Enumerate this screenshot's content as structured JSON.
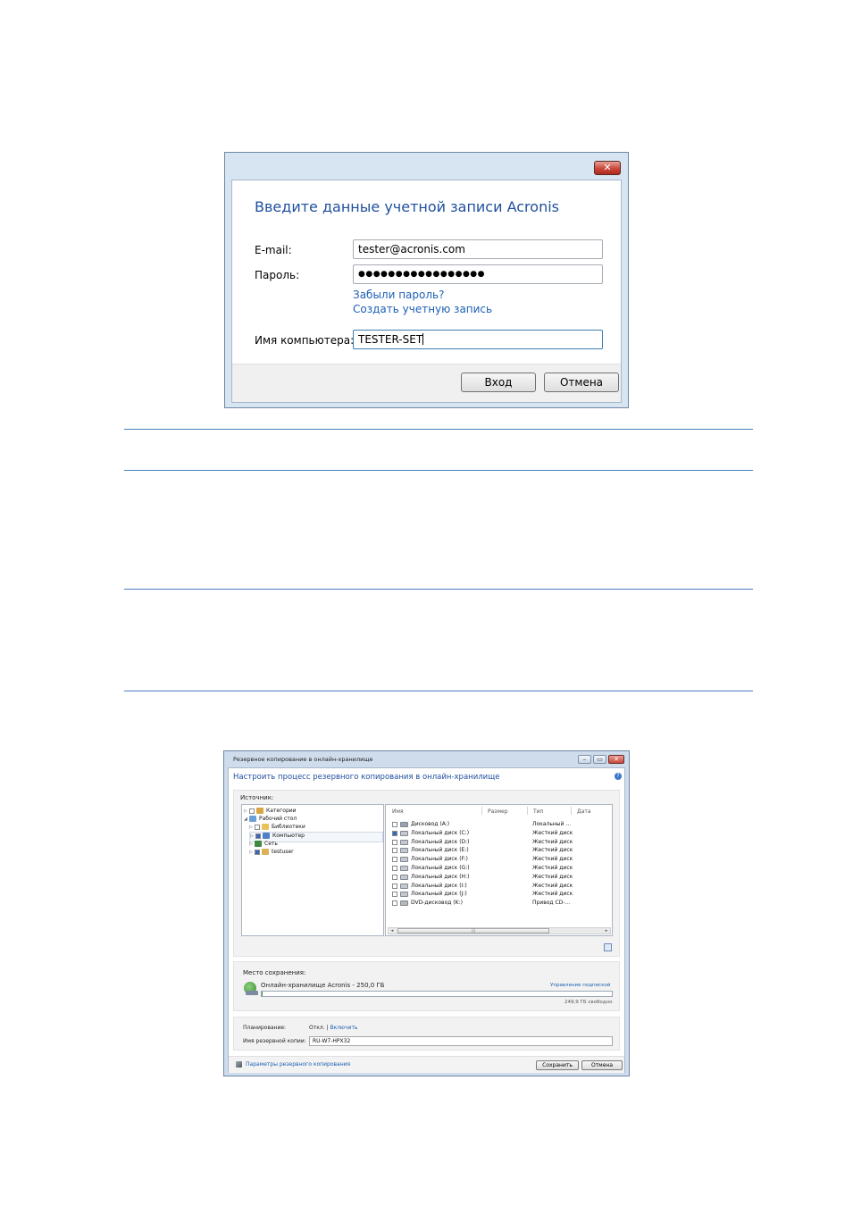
{
  "login_dialog": {
    "close_label": "✕",
    "title": "Введите данные учетной записи Acronis",
    "email_label": "E-mail:",
    "email_value": "tester@acronis.com",
    "password_label": "Пароль:",
    "password_value": "●●●●●●●●●●●●●●●●●",
    "forgot_password": "Забыли пароль?",
    "create_account": "Создать учетную запись",
    "computer_label": "Имя компьютера:",
    "computer_value": "TESTER-SET",
    "login_button": "Вход",
    "cancel_button": "Отмена"
  },
  "backup_dialog": {
    "window_title": "Резервное копирование в онлайн-хранилище",
    "window_buttons": [
      "–",
      "▭",
      "✕"
    ],
    "heading": "Настроить процесс резервного копирования в онлайн-хранилище",
    "help_icon": "?",
    "source_label": "Источник:",
    "tree": [
      {
        "label": "Категории",
        "expander": "▷",
        "icon": "#d9a441"
      },
      {
        "label": "Рабочий стол",
        "expander": "◢",
        "icon": "#6a9fd8"
      },
      {
        "label": "Библиотеки",
        "expander": "▷",
        "icon": "#e8c35a"
      },
      {
        "label": "Компьютер",
        "expander": "▷",
        "icon": "#4f7fc4"
      },
      {
        "label": "Сеть",
        "expander": "▷",
        "icon": "#3f8a3f"
      },
      {
        "label": "testuser",
        "expander": "▷",
        "icon": "#d9b356"
      }
    ],
    "columns": [
      "Имя",
      "Размер",
      "Тип",
      "Дата"
    ],
    "files": [
      {
        "name": "Дисковод (A:)",
        "type": "Локальный ..."
      },
      {
        "name": "Локальный диск (C:)",
        "type": "Жесткий диск"
      },
      {
        "name": "Локальный диск (D:)",
        "type": "Жесткий диск"
      },
      {
        "name": "Локальный диск (E:)",
        "type": "Жесткий диск"
      },
      {
        "name": "Локальный диск (F:)",
        "type": "Жесткий диск"
      },
      {
        "name": "Локальный диск (G:)",
        "type": "Жесткий диск"
      },
      {
        "name": "Локальный диск (H:)",
        "type": "Жесткий диск"
      },
      {
        "name": "Локальный диск (I:)",
        "type": "Жесткий диск"
      },
      {
        "name": "Локальный диск (J:)",
        "type": "Жесткий диск"
      },
      {
        "name": "DVD-дисковод (K:)",
        "type": "Привод CD-..."
      }
    ],
    "scroll_left": "◂",
    "scroll_right": "▸",
    "scroll_grip": "|||",
    "destination_label": "Место сохранения:",
    "storage_name": "Онлайн-хранилище Acronis - 250,0 ГБ",
    "manage_subscription": "Управление подпиской",
    "storage_free": "249,9 ГБ свободно",
    "storage_used_fraction": 0.0004,
    "schedule_label": "Планирование:",
    "schedule_off": "Откл.",
    "schedule_separator": "|",
    "schedule_enable": "Включить",
    "backup_name_label": "Имя резервной копии:",
    "backup_name_value": "RU-W7-HPX32",
    "options_link": "Параметры резервного копирования",
    "save_button": "Сохранить",
    "cancel_button": "Отмена"
  }
}
